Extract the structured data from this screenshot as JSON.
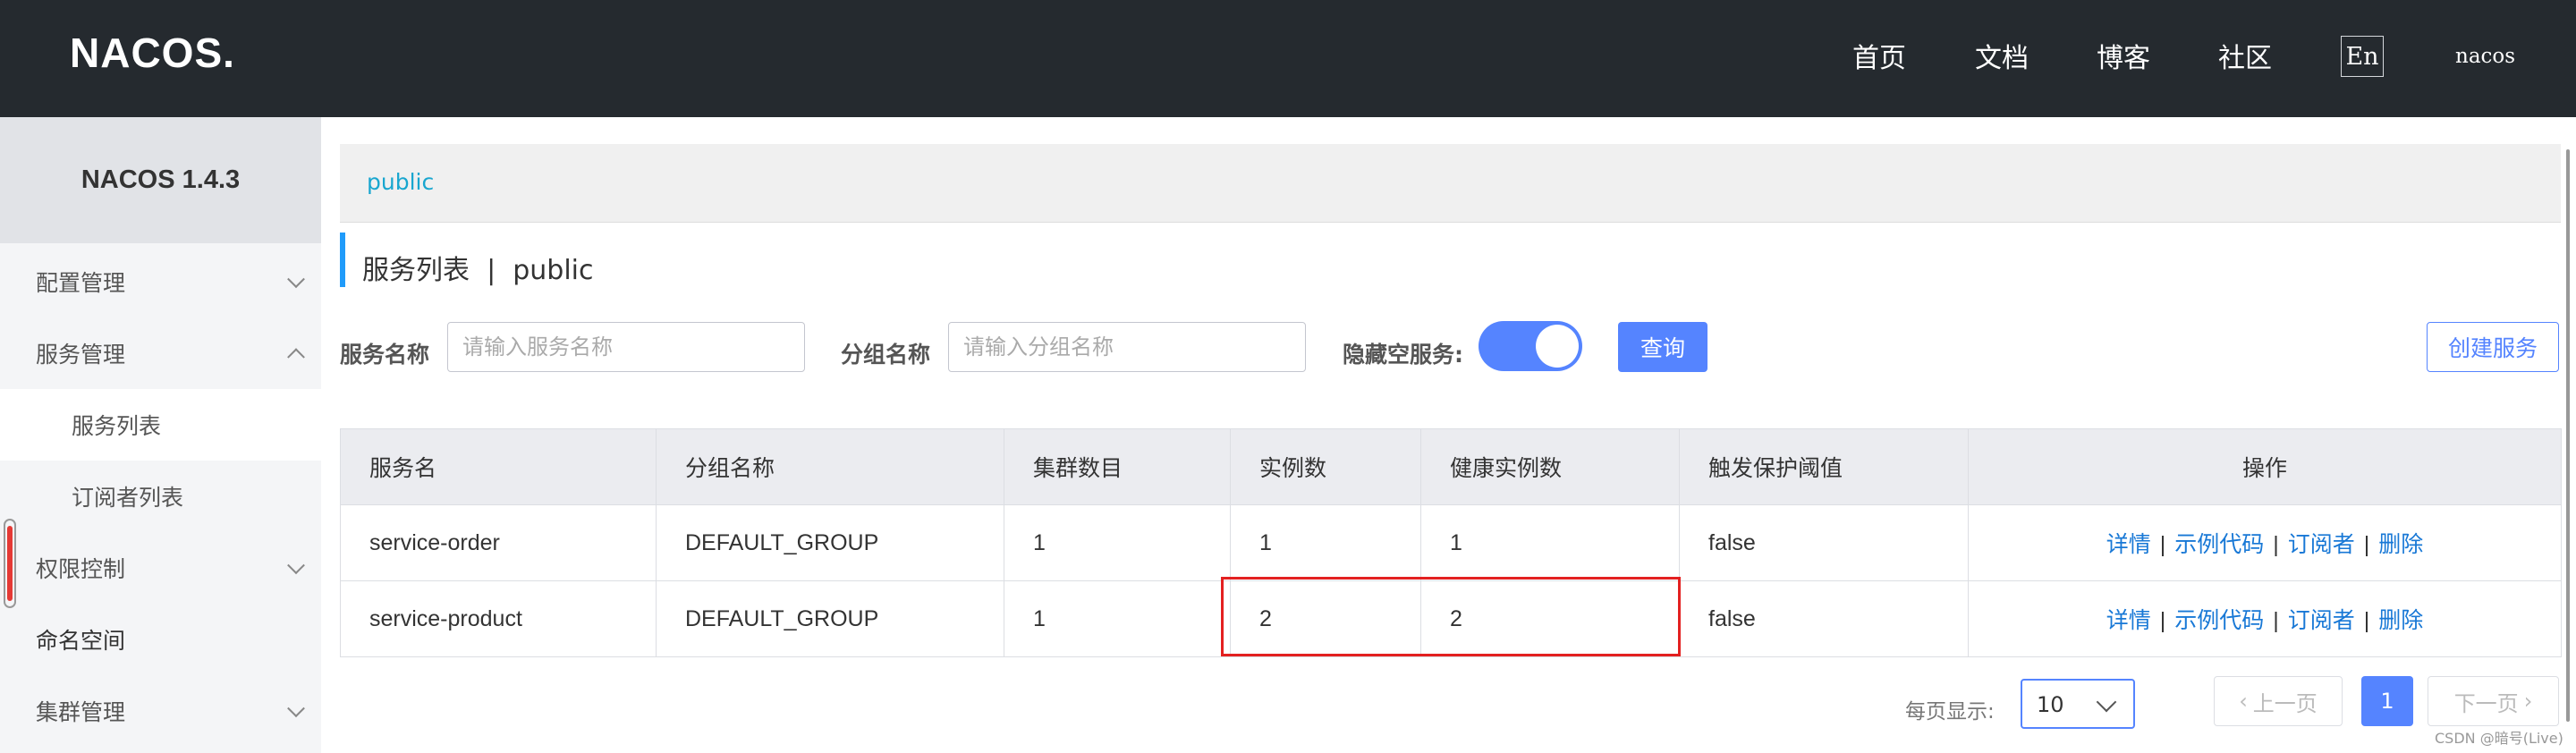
{
  "header": {
    "logo_text": "NACOS.",
    "nav": [
      "首页",
      "文档",
      "博客",
      "社区"
    ],
    "lang": "En",
    "user": "nacos"
  },
  "sidebar": {
    "title": "NACOS 1.4.3",
    "items": [
      {
        "label": "配置管理",
        "chevron": "down"
      },
      {
        "label": "服务管理",
        "chevron": "up"
      },
      {
        "label": "服务列表",
        "sub": true,
        "active": true
      },
      {
        "label": "订阅者列表",
        "sub": true
      },
      {
        "label": "权限控制",
        "chevron": "down"
      },
      {
        "label": "命名空间"
      },
      {
        "label": "集群管理",
        "chevron": "down"
      }
    ]
  },
  "breadcrumb": {
    "namespace": "public"
  },
  "page": {
    "title": "服务列表  |  public"
  },
  "filters": {
    "service_name_label": "服务名称",
    "service_name_placeholder": "请输入服务名称",
    "group_name_label": "分组名称",
    "group_name_placeholder": "请输入分组名称",
    "hide_empty_label": "隐藏空服务:",
    "hide_empty_on": true,
    "query_label": "查询",
    "create_label": "创建服务"
  },
  "table": {
    "columns": [
      "服务名",
      "分组名称",
      "集群数目",
      "实例数",
      "健康实例数",
      "触发保护阈值",
      "操作"
    ],
    "rows": [
      [
        "service-order",
        "DEFAULT_GROUP",
        "1",
        "1",
        "1",
        "false"
      ],
      [
        "service-product",
        "DEFAULT_GROUP",
        "1",
        "2",
        "2",
        "false"
      ]
    ],
    "ops": [
      "详情",
      "示例代码",
      "订阅者",
      "删除"
    ]
  },
  "pager": {
    "page_size_label": "每页显示:",
    "page_size": "10",
    "prev": "上一页",
    "current": "1",
    "next": "下一页"
  },
  "watermark": "CSDN @暗号(Live)",
  "colors": {
    "accent": "#5584ff",
    "topbar": "#252a2f",
    "highlight": "#e32020",
    "link": "#1878d6"
  }
}
